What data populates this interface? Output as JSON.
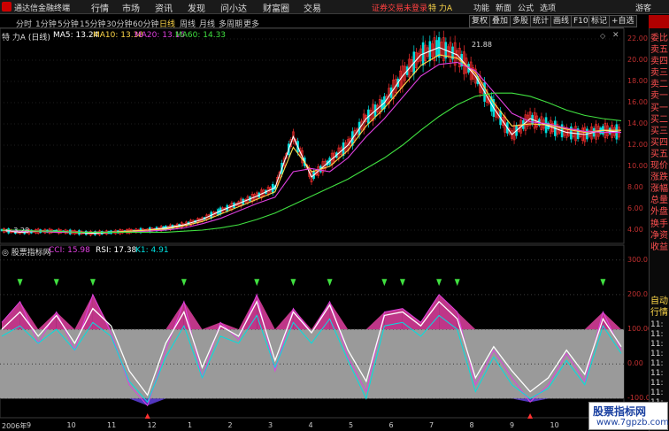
{
  "titlebar": {
    "app_name": "通达信金融终端",
    "menus": [
      "行情",
      "市场",
      "资讯",
      "发现",
      "问小达",
      "财富圈",
      "交易"
    ],
    "notice": "证券交易未登录",
    "stock": "特 力A",
    "right_menus": [
      "功能",
      "新面",
      "公式",
      "选项",
      "游客"
    ]
  },
  "periodbar": {
    "periods": [
      "分时",
      "1分钟",
      "5分钟",
      "15分钟",
      "30分钟",
      "60分钟",
      "日线",
      "周线",
      "月线",
      "多周期",
      "更多"
    ],
    "active": "日线",
    "tools": [
      "复权",
      "叠加",
      "多股",
      "统计",
      "画线",
      "F10",
      "标记",
      "+自选"
    ]
  },
  "main_header": {
    "stock_label": "特 力A (日线)",
    "ma5": "MA5: 13.24",
    "ma10": "MA10: 13.38",
    "ma20": "MA20: 13.16",
    "ma60": "MA60: 14.33"
  },
  "price_axis": [
    "22.00",
    "20.00",
    "18.00",
    "16.00",
    "14.00",
    "12.00",
    "10.00",
    "8.00",
    "6.00",
    "4.00"
  ],
  "price_annotations": {
    "high": "21.88",
    "low": "3.28"
  },
  "indicator": {
    "name": "股票指标网",
    "cci": "CCI: 15.98",
    "rsi": "RSI: 17.38",
    "k1": "K1: 4.91",
    "axis": [
      "300.0",
      "200.0",
      "100.00",
      "0.00",
      "-100.00"
    ]
  },
  "dates": [
    "2006年",
    "9",
    "10",
    "11",
    "12",
    "1",
    "2",
    "3",
    "4",
    "5",
    "6",
    "7",
    "8",
    "9",
    "10",
    "11"
  ],
  "right_panel": {
    "top_label": "委比",
    "items": [
      "卖五",
      "卖四",
      "卖三",
      "卖二",
      "卖一",
      "买一",
      "买二",
      "买三",
      "买四",
      "买五",
      "现价",
      "涨跌",
      "涨幅",
      "总量",
      "外盘",
      "换手",
      "净资",
      "收益"
    ],
    "bottom": [
      "自动",
      "行情"
    ],
    "times": [
      "11:",
      "11:",
      "11:",
      "11:",
      "11:",
      "11:",
      "11:",
      "11:",
      "11:"
    ]
  },
  "watermark": {
    "line1": "股票指标网",
    "line2": "www.7gpzb.com"
  },
  "colors": {
    "ma5": "#ffffff",
    "ma10": "#ffd84a",
    "ma20": "#e040e0",
    "ma60": "#40e040",
    "up": "#ff3030",
    "cci": "#e040e0",
    "rsi": "#ffffff",
    "k1": "#00e0e0"
  },
  "chart_data": [
    {
      "type": "line",
      "title": "",
      "y_axis_ticks": [
        4,
        6,
        8,
        10,
        12,
        14,
        16,
        18,
        20,
        22
      ],
      "ylim": [
        3,
        22.5
      ],
      "x": [
        0,
        10,
        20,
        30,
        40,
        50,
        60,
        70,
        80,
        90,
        100,
        110,
        120,
        130,
        140,
        150,
        160,
        170,
        180,
        190,
        200,
        210,
        220,
        230,
        240,
        250,
        260,
        270,
        280,
        290,
        300,
        310,
        320,
        330,
        340
      ],
      "series": [
        {
          "name": "MA5",
          "values": [
            4.0,
            3.8,
            3.9,
            3.9,
            3.8,
            3.7,
            3.8,
            3.9,
            4.0,
            4.2,
            4.5,
            5.0,
            5.8,
            6.5,
            7.2,
            8.0,
            12.8,
            9.0,
            10.5,
            12.0,
            14.5,
            16.0,
            18.5,
            20.5,
            21.2,
            20.5,
            18.5,
            15.5,
            13.0,
            14.5,
            13.8,
            13.2,
            13.0,
            13.4,
            13.2
          ]
        },
        {
          "name": "MA10",
          "values": [
            4.0,
            3.9,
            3.9,
            3.8,
            3.8,
            3.8,
            3.8,
            3.9,
            4.0,
            4.1,
            4.4,
            4.8,
            5.5,
            6.2,
            6.9,
            7.6,
            11.8,
            9.5,
            10.0,
            11.5,
            13.8,
            15.5,
            17.5,
            19.5,
            20.5,
            20.2,
            18.8,
            16.0,
            13.8,
            14.0,
            13.9,
            13.5,
            13.2,
            13.4,
            13.4
          ]
        },
        {
          "name": "MA20",
          "values": [
            4.0,
            3.9,
            3.9,
            3.8,
            3.8,
            3.8,
            3.8,
            3.8,
            3.9,
            4.0,
            4.2,
            4.6,
            5.1,
            5.8,
            6.5,
            7.1,
            9.5,
            9.8,
            9.5,
            10.8,
            12.8,
            14.5,
            16.5,
            18.5,
            19.6,
            19.8,
            19.0,
            17.0,
            15.0,
            14.2,
            14.0,
            13.6,
            13.3,
            13.2,
            13.2
          ]
        },
        {
          "name": "MA60",
          "values": [
            4.0,
            4.0,
            3.9,
            3.9,
            3.8,
            3.8,
            3.8,
            3.8,
            3.8,
            3.8,
            3.9,
            4.0,
            4.2,
            4.5,
            5.0,
            5.6,
            6.4,
            7.2,
            8.0,
            8.8,
            9.8,
            10.8,
            12.0,
            13.4,
            14.7,
            15.8,
            16.6,
            16.9,
            16.9,
            16.6,
            16.0,
            15.3,
            14.8,
            14.5,
            14.3
          ]
        }
      ]
    },
    {
      "type": "line",
      "title": "",
      "y_axis_ticks": [
        -100,
        0,
        100,
        200,
        300
      ],
      "ylim": [
        -150,
        330
      ],
      "x": [
        0,
        10,
        20,
        30,
        40,
        50,
        60,
        70,
        80,
        90,
        100,
        110,
        120,
        130,
        140,
        150,
        160,
        170,
        180,
        190,
        200,
        210,
        220,
        230,
        240,
        250,
        260,
        270,
        280,
        290,
        300,
        310,
        320,
        330,
        340
      ],
      "series": [
        {
          "name": "CCI",
          "values": [
            120,
            180,
            60,
            150,
            40,
            200,
            90,
            -60,
            -120,
            40,
            180,
            -40,
            120,
            70,
            200,
            -20,
            160,
            90,
            180,
            20,
            -80,
            150,
            160,
            120,
            200,
            150,
            -60,
            40,
            -40,
            -110,
            -60,
            30,
            -50,
            150,
            40
          ]
        },
        {
          "name": "RSI",
          "values": [
            100,
            150,
            80,
            140,
            60,
            160,
            110,
            -20,
            -90,
            60,
            150,
            -10,
            110,
            80,
            180,
            10,
            150,
            90,
            170,
            40,
            -50,
            140,
            150,
            110,
            180,
            130,
            -40,
            50,
            -20,
            -80,
            -40,
            40,
            -30,
            130,
            50
          ]
        },
        {
          "name": "K1",
          "values": [
            80,
            110,
            60,
            100,
            40,
            120,
            80,
            -50,
            -110,
            20,
            110,
            -40,
            80,
            60,
            140,
            -10,
            120,
            60,
            130,
            10,
            -100,
            110,
            120,
            80,
            140,
            100,
            -80,
            20,
            -60,
            -100,
            -70,
            10,
            -60,
            110,
            30
          ]
        }
      ]
    }
  ]
}
